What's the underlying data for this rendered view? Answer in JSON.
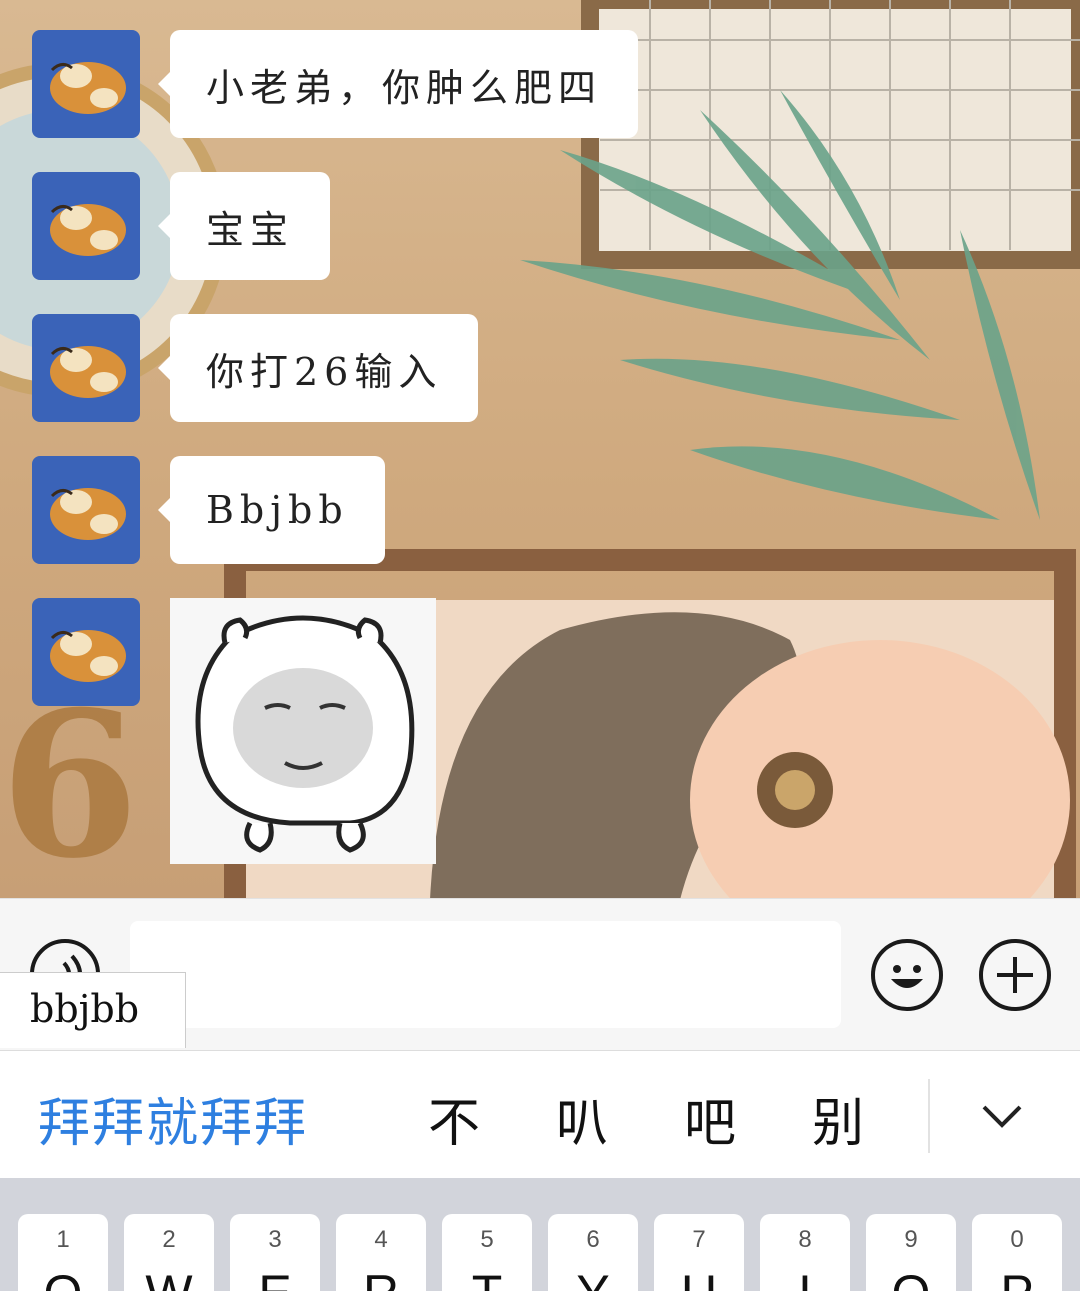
{
  "messages": [
    {
      "text": "小老弟，你肿么肥四"
    },
    {
      "text": "宝宝"
    },
    {
      "text": "你打26输入"
    },
    {
      "text": "Bbjbb"
    },
    {
      "text": ""
    }
  ],
  "composer": {
    "text": "bbjbb"
  },
  "candidates": [
    "拜拜就拜拜",
    "不",
    "叭",
    "吧",
    "别"
  ],
  "keyboard": {
    "keys": [
      {
        "num": "1",
        "letter": "Q"
      },
      {
        "num": "2",
        "letter": "W"
      },
      {
        "num": "3",
        "letter": "E"
      },
      {
        "num": "4",
        "letter": "R"
      },
      {
        "num": "5",
        "letter": "T"
      },
      {
        "num": "6",
        "letter": "Y"
      },
      {
        "num": "7",
        "letter": "U"
      },
      {
        "num": "8",
        "letter": "I"
      },
      {
        "num": "9",
        "letter": "O"
      },
      {
        "num": "0",
        "letter": "P"
      }
    ]
  },
  "colors": {
    "accent": "#2e7fe0",
    "avatar": "#3a63b8",
    "keyboard": "#d2d4db"
  },
  "icons": [
    "voice-icon",
    "emoji-icon",
    "plus-icon",
    "chevron-down-icon"
  ]
}
